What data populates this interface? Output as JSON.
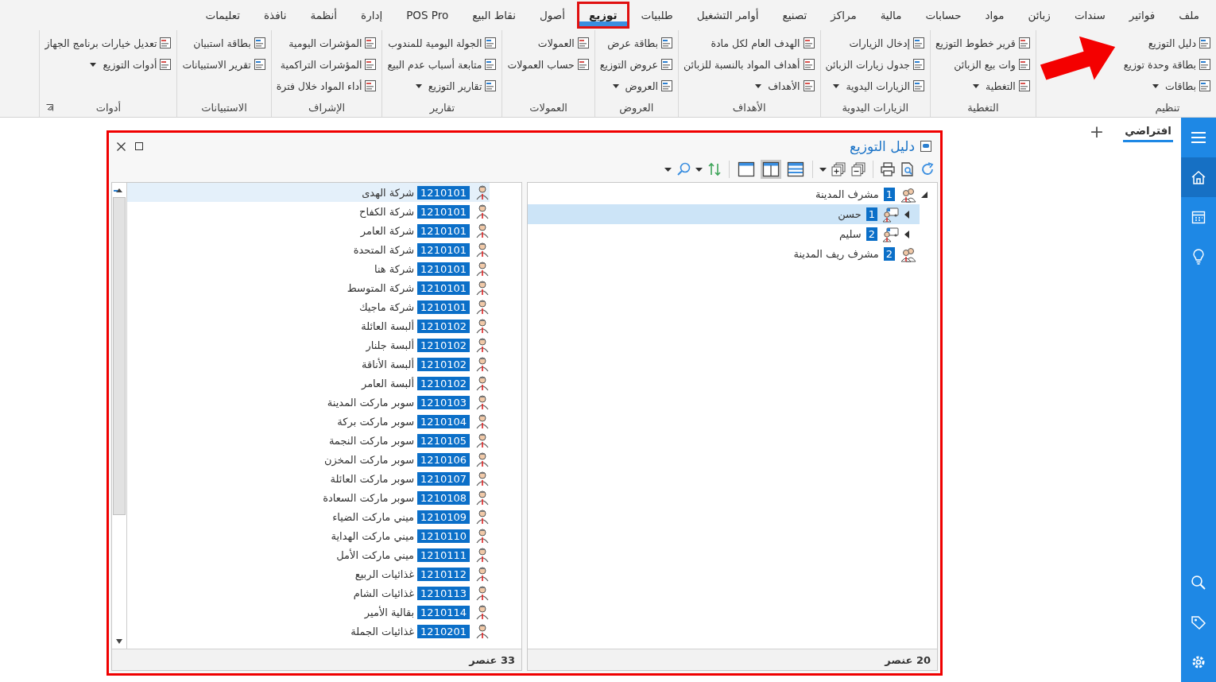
{
  "menu_tabs": [
    {
      "label": "ملف",
      "selected": false,
      "highlighted": false
    },
    {
      "label": "فواتير",
      "selected": false,
      "highlighted": false
    },
    {
      "label": "سندات",
      "selected": false,
      "highlighted": false
    },
    {
      "label": "زبائن",
      "selected": false,
      "highlighted": false
    },
    {
      "label": "مواد",
      "selected": false,
      "highlighted": false
    },
    {
      "label": "حسابات",
      "selected": false,
      "highlighted": false
    },
    {
      "label": "مالية",
      "selected": false,
      "highlighted": false
    },
    {
      "label": "مراكز",
      "selected": false,
      "highlighted": false
    },
    {
      "label": "تصنيع",
      "selected": false,
      "highlighted": false
    },
    {
      "label": "أوامر التشغيل",
      "selected": false,
      "highlighted": false
    },
    {
      "label": "طلبيات",
      "selected": false,
      "highlighted": false
    },
    {
      "label": "توزيع",
      "selected": true,
      "highlighted": true
    },
    {
      "label": "أصول",
      "selected": false,
      "highlighted": false
    },
    {
      "label": "نقاط البيع",
      "selected": false,
      "highlighted": false
    },
    {
      "label": "POS Pro",
      "selected": false,
      "highlighted": false
    },
    {
      "label": "إدارة",
      "selected": false,
      "highlighted": false
    },
    {
      "label": "أنظمة",
      "selected": false,
      "highlighted": false
    },
    {
      "label": "نافذة",
      "selected": false,
      "highlighted": false
    },
    {
      "label": "تعليمات",
      "selected": false,
      "highlighted": false
    }
  ],
  "ribbon": {
    "pointer_arrow": true,
    "groups": [
      {
        "label": "تنظيم",
        "items": [
          {
            "label": "دليل التوزيع",
            "has_menu": false
          },
          {
            "label": "بطاقة وحدة توزيع",
            "has_menu": false
          },
          {
            "label": "بطاقات",
            "has_menu": true
          }
        ]
      },
      {
        "label": "التغطية",
        "items": [
          {
            "label": "قرير خطوط التوزيع",
            "has_menu": false
          },
          {
            "label": "وات بيع الزبائن",
            "has_menu": false
          },
          {
            "label": "التغطية",
            "has_menu": true
          }
        ]
      },
      {
        "label": "الزيارات اليدوية",
        "items": [
          {
            "label": "إدخال الزيارات",
            "has_menu": false
          },
          {
            "label": "جدول زيارات الزبائن",
            "has_menu": false
          },
          {
            "label": "الزيارات اليدوية",
            "has_menu": true
          }
        ]
      },
      {
        "label": "الأهداف",
        "items": [
          {
            "label": "الهدف العام لكل مادة",
            "has_menu": false
          },
          {
            "label": "أهداف المواد بالنسبة للزبائن",
            "has_menu": false
          },
          {
            "label": "الأهداف",
            "has_menu": true
          }
        ]
      },
      {
        "label": "العروض",
        "items": [
          {
            "label": "بطاقة عرض",
            "has_menu": false
          },
          {
            "label": "عروض التوزيع",
            "has_menu": false
          },
          {
            "label": "العروض",
            "has_menu": true
          }
        ]
      },
      {
        "label": "العمولات",
        "items": [
          {
            "label": "العمولات",
            "has_menu": false
          },
          {
            "label": "حساب العمولات",
            "has_menu": false
          }
        ]
      },
      {
        "label": "تقارير",
        "items": [
          {
            "label": "الجولة اليومية للمندوب",
            "has_menu": false
          },
          {
            "label": "متابعة أسباب عدم البيع",
            "has_menu": false
          },
          {
            "label": "تقارير التوزيع",
            "has_menu": true
          }
        ]
      },
      {
        "label": "الإشراف",
        "items": [
          {
            "label": "المؤشرات اليومية",
            "has_menu": false
          },
          {
            "label": "المؤشرات التراكمية",
            "has_menu": false
          },
          {
            "label": "أداء المواد خلال فترة",
            "has_menu": false
          }
        ]
      },
      {
        "label": "الاستبيانات",
        "items": [
          {
            "label": "بطاقة استبيان",
            "has_menu": false
          },
          {
            "label": "تقرير الاستبيانات",
            "has_menu": false
          }
        ]
      },
      {
        "label": "أدوات",
        "launcher": true,
        "items": [
          {
            "label": "تعديل خيارات برنامج الجهاز",
            "has_menu": false
          },
          {
            "label": "أدوات التوزيع",
            "has_menu": true
          }
        ]
      }
    ]
  },
  "document_tabs": [
    {
      "label": "افتراضي",
      "selected": true
    }
  ],
  "add_tab": "+",
  "sidebar": {
    "top": [
      {
        "kind": "menu",
        "selected": false
      },
      {
        "kind": "home",
        "selected": true
      },
      {
        "kind": "calendar",
        "selected": false
      },
      {
        "kind": "bulb",
        "selected": false
      }
    ],
    "bottom": [
      {
        "kind": "search",
        "selected": false
      },
      {
        "kind": "tag",
        "selected": false
      },
      {
        "kind": "settings",
        "selected": false
      }
    ]
  },
  "window": {
    "title": "دليل التوزيع",
    "highlighted": true,
    "toolbar": [
      {
        "kind": "refresh"
      },
      {
        "kind": "preview"
      },
      {
        "kind": "print"
      },
      {
        "kind": "sep"
      },
      {
        "kind": "collapse"
      },
      {
        "kind": "expand"
      },
      {
        "kind": "caret"
      },
      {
        "kind": "sep"
      },
      {
        "kind": "rows",
        "selected": false
      },
      {
        "kind": "columns",
        "selected": true
      },
      {
        "kind": "single",
        "selected": false
      },
      {
        "kind": "sep"
      },
      {
        "kind": "sort"
      },
      {
        "kind": "caret"
      },
      {
        "kind": "search"
      },
      {
        "kind": "caret"
      }
    ],
    "tree": {
      "footer": "20 عنصر",
      "items": [
        {
          "kind": "supervisor",
          "badge": "1",
          "label": "مشرف المدينة",
          "expanded": true,
          "selected": false,
          "children": [
            {
              "kind": "salesman",
              "badge": "1",
              "label": "حسن",
              "expanded": false,
              "selected": true
            },
            {
              "kind": "salesman",
              "badge": "2",
              "label": "سليم",
              "expanded": false,
              "selected": false
            }
          ]
        },
        {
          "kind": "supervisor",
          "badge": "2",
          "label": "مشرف ريف المدينة",
          "selected": false
        }
      ]
    },
    "list": {
      "footer": "33 عنصر",
      "rows": [
        {
          "code": "1210101",
          "name": "شركة الهدى",
          "selected": true
        },
        {
          "code": "1210101",
          "name": "شركة الكفاح",
          "selected": false
        },
        {
          "code": "1210101",
          "name": "شركة العامر",
          "selected": false
        },
        {
          "code": "1210101",
          "name": "شركة المتحدة",
          "selected": false
        },
        {
          "code": "1210101",
          "name": "شركة هنا",
          "selected": false
        },
        {
          "code": "1210101",
          "name": "شركة المتوسط",
          "selected": false
        },
        {
          "code": "1210101",
          "name": "شركة ماجيك",
          "selected": false
        },
        {
          "code": "1210102",
          "name": "ألبسة العائلة",
          "selected": false
        },
        {
          "code": "1210102",
          "name": "ألبسة جلنار",
          "selected": false
        },
        {
          "code": "1210102",
          "name": "ألبسة الأناقة",
          "selected": false
        },
        {
          "code": "1210102",
          "name": "ألبسة العامر",
          "selected": false
        },
        {
          "code": "1210103",
          "name": "سوبر ماركت المدينة",
          "selected": false
        },
        {
          "code": "1210104",
          "name": "سوبر ماركت بركة",
          "selected": false
        },
        {
          "code": "1210105",
          "name": "سوبر ماركت النجمة",
          "selected": false
        },
        {
          "code": "1210106",
          "name": "سوبر ماركت المخزن",
          "selected": false
        },
        {
          "code": "1210107",
          "name": "سوبر ماركت العائلة",
          "selected": false
        },
        {
          "code": "1210108",
          "name": "سوبر ماركت السعادة",
          "selected": false
        },
        {
          "code": "1210109",
          "name": "ميني ماركت الضياء",
          "selected": false
        },
        {
          "code": "1210110",
          "name": "ميني ماركت الهداية",
          "selected": false
        },
        {
          "code": "1210111",
          "name": "ميني ماركت الأمل",
          "selected": false
        },
        {
          "code": "1210112",
          "name": "غذائيات الربيع",
          "selected": false
        },
        {
          "code": "1210113",
          "name": "غذائيات الشام",
          "selected": false
        },
        {
          "code": "1210114",
          "name": "بقالية الأمير",
          "selected": false
        },
        {
          "code": "1210201",
          "name": "غذائيات الجملة",
          "selected": false
        }
      ]
    }
  }
}
